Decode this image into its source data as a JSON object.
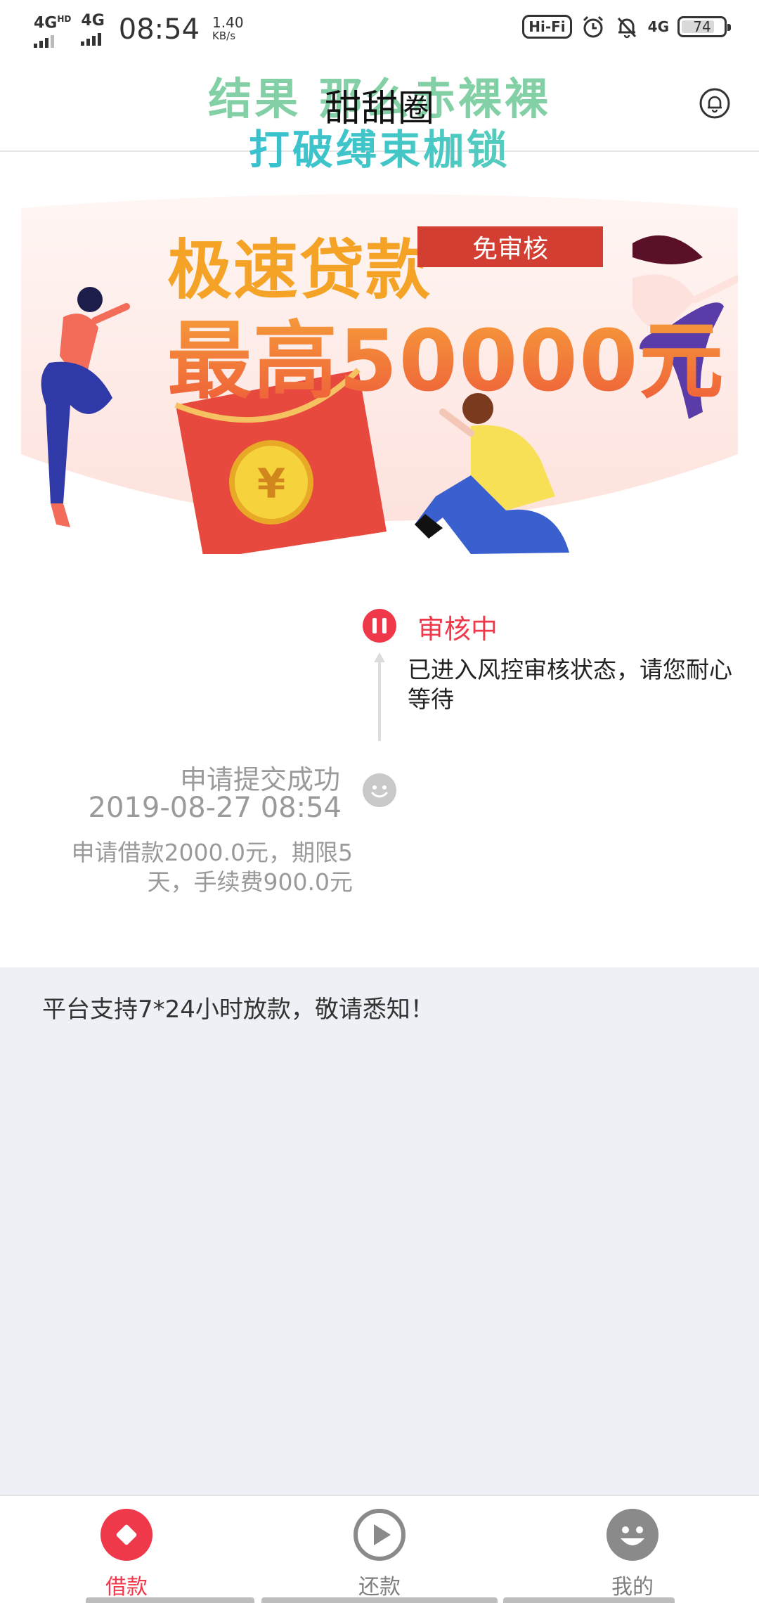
{
  "status_bar": {
    "signal1": "4G",
    "signal1_sup": "HD",
    "signal2": "4G",
    "time": "08:54",
    "speed_value": "1.40",
    "speed_unit": "KB/s",
    "hifi": "Hi-Fi",
    "net4g": "4G",
    "battery": "74",
    "icons": [
      "alarm-icon",
      "bell-off-icon"
    ]
  },
  "nav": {
    "title": "甜甜圈",
    "watermark_line1": "结果 那么赤裸裸",
    "watermark_line2": "打破缚束枷锁",
    "right_icon": "bell-icon"
  },
  "banner": {
    "line1": "极速贷款",
    "tag": "免审核",
    "line2": "最高50000元"
  },
  "timeline": {
    "current": {
      "title": "审核中",
      "desc": "已进入风控审核状态，请您耐心等待",
      "icon": "pause-icon"
    },
    "previous": {
      "title": "申请提交成功",
      "time": "2019-08-27 08:54",
      "desc": "申请借款2000.0元，期限5天，手续费900.0元",
      "icon": "smile-icon"
    }
  },
  "notice": {
    "text": "平台支持7*24小时放款，敬请悉知！"
  },
  "tabs": [
    {
      "label": "借款",
      "icon": "loan-icon",
      "active": true
    },
    {
      "label": "还款",
      "icon": "play-icon",
      "active": false
    },
    {
      "label": "我的",
      "icon": "profile-icon",
      "active": false
    }
  ],
  "colors": {
    "accent": "#f0384b",
    "notice_bg": "#edf0f5",
    "muted_text": "#9a9a9a"
  }
}
